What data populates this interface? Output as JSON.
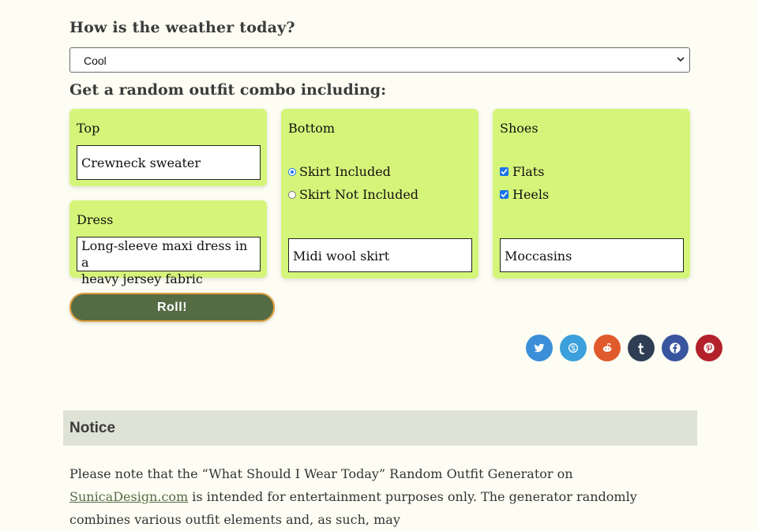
{
  "weather": {
    "question": "How is the weather today?",
    "selected": "Cool"
  },
  "combo_heading": "Get a random outfit combo including:",
  "cards": {
    "top": {
      "title": "Top",
      "value": "Crewneck sweater"
    },
    "dress": {
      "title": "Dress",
      "value_line1": "Long-sleeve maxi dress in a",
      "value_line2": "heavy jersey fabric"
    },
    "bottom": {
      "title": "Bottom",
      "option1": "Skirt Included",
      "option2": "Skirt Not Included",
      "selected": "Skirt Included",
      "value": "Midi wool skirt"
    },
    "shoes": {
      "title": "Shoes",
      "option1": "Flats",
      "option1_checked": true,
      "option2": "Heels",
      "option2_checked": true,
      "value": "Moccasins"
    }
  },
  "roll_button": "Roll!",
  "share_icons": [
    {
      "name": "twitter-icon",
      "color": "#3b8fd9"
    },
    {
      "name": "skype-icon",
      "color": "#3ba0db"
    },
    {
      "name": "reddit-icon",
      "color": "#e05a2b"
    },
    {
      "name": "tumblr-icon",
      "color": "#2f3e55"
    },
    {
      "name": "facebook-icon",
      "color": "#3a559f"
    },
    {
      "name": "pinterest-icon",
      "color": "#b3222a"
    }
  ],
  "notice": {
    "heading": "Notice",
    "text_before": "Please note that the “What Should I Wear Today” Random Outfit Generator on ",
    "link": "SunicaDesign.com",
    "text_after": " is intended for entertainment purposes only. The generator randomly combines various outfit elements and, as such, may"
  }
}
